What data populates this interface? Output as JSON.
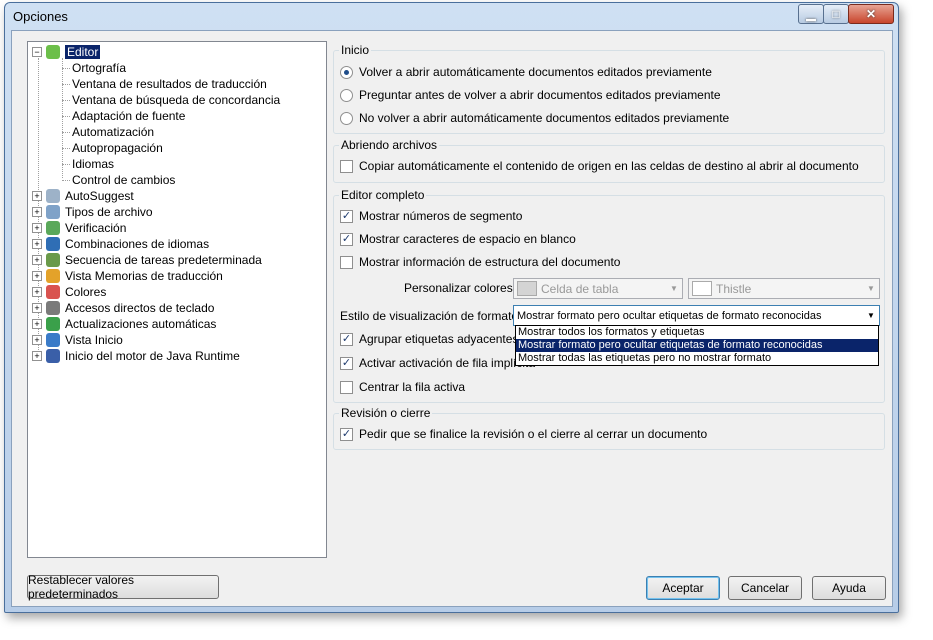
{
  "window": {
    "title": "Opciones"
  },
  "tree": {
    "editor": {
      "label": "Editor",
      "children": [
        "Ortografía",
        "Ventana de resultados de traducción",
        "Ventana de búsqueda de concordancia",
        "Adaptación de fuente",
        "Automatización",
        "Autopropagación",
        "Idiomas",
        "Control de cambios"
      ]
    },
    "top_items": [
      {
        "label": "AutoSuggest",
        "icon": "autosuggest-icon",
        "color": "#9db2c8"
      },
      {
        "label": "Tipos de archivo",
        "icon": "file-types-icon",
        "color": "#7fa2c8"
      },
      {
        "label": "Verificación",
        "icon": "verification-icon",
        "color": "#5aa85a"
      },
      {
        "label": "Combinaciones de idiomas",
        "icon": "language-pairs-icon",
        "color": "#2f6eb5"
      },
      {
        "label": "Secuencia de tareas predeterminada",
        "icon": "task-sequence-icon",
        "color": "#6a9a4a"
      },
      {
        "label": "Vista Memorias de traducción",
        "icon": "translation-memories-icon",
        "color": "#e3a22a"
      },
      {
        "label": "Colores",
        "icon": "colors-icon",
        "color": "#d9534f"
      },
      {
        "label": "Accesos directos de teclado",
        "icon": "keyboard-shortcuts-icon",
        "color": "#7a7a7a"
      },
      {
        "label": "Actualizaciones automáticas",
        "icon": "auto-updates-icon",
        "color": "#3aa04a"
      },
      {
        "label": "Vista Inicio",
        "icon": "home-view-icon",
        "color": "#3a7bc8"
      },
      {
        "label": "Inicio del motor de Java Runtime",
        "icon": "java-runtime-icon",
        "color": "#3a5fa8"
      }
    ]
  },
  "inicio": {
    "title": "Inicio",
    "options": [
      "Volver a abrir automáticamente documentos editados previamente",
      "Preguntar antes de volver a abrir documentos editados previamente",
      "No volver a abrir automáticamente documentos editados previamente"
    ],
    "selected_index": 0
  },
  "abriendo": {
    "title": "Abriendo archivos",
    "copy_source_label": "Copiar automáticamente el contenido de origen en las celdas de destino al abrir al documento",
    "copy_source_checked": false
  },
  "editor_completo": {
    "title": "Editor completo",
    "show_segment_numbers": {
      "label": "Mostrar números de segmento",
      "checked": true
    },
    "show_whitespace": {
      "label": "Mostrar caracteres de espacio en blanco",
      "checked": true
    },
    "show_structure": {
      "label": "Mostrar información de estructura del documento",
      "checked": false
    },
    "colors_label": "Personalizar colores:",
    "color1": "Celda de tabla",
    "color2": "Thistle",
    "format_label": "Estilo de visualización de formato:",
    "format_value": "Mostrar formato pero ocultar etiquetas de formato reconocidas",
    "format_options": [
      "Mostrar todos los formatos y etiquetas",
      "Mostrar formato pero ocultar etiquetas de formato reconocidas",
      "Mostrar todas las etiquetas pero no mostrar formato"
    ],
    "format_selected_index": 1,
    "group_tags": {
      "label": "Agrupar etiquetas adyacentes en",
      "checked": true
    },
    "activate_row": {
      "label": "Activar activación de fila implícita",
      "checked": true
    },
    "center_row": {
      "label": "Centrar la fila activa",
      "checked": false
    }
  },
  "revision": {
    "title": "Revisión o cierre",
    "finalize_label": "Pedir que se finalice la revisión o el cierre al cerrar un documento",
    "finalize_checked": true
  },
  "buttons": {
    "reset": "Restablecer valores predeterminados",
    "ok": "Aceptar",
    "cancel": "Cancelar",
    "help": "Ayuda"
  },
  "colors": {
    "selection": "#0a246a",
    "swatch_table_cell": "#d4d4d4",
    "swatch_thistle": "#ffffff"
  }
}
